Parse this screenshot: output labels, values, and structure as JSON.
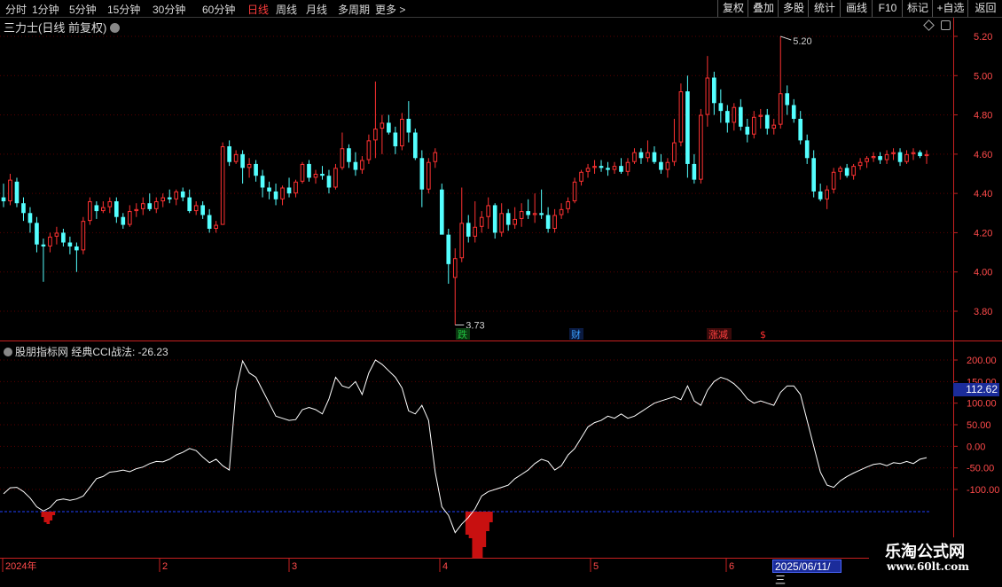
{
  "toolbar": {
    "periods": [
      {
        "label": "分时",
        "active": false
      },
      {
        "label": "1分钟",
        "active": false
      },
      {
        "label": "5分钟",
        "active": false
      },
      {
        "label": "15分钟",
        "active": false
      },
      {
        "label": "30分钟",
        "active": false
      },
      {
        "label": "60分钟",
        "active": false
      },
      {
        "label": "日线",
        "active": true
      },
      {
        "label": "周线",
        "active": false
      },
      {
        "label": "月线",
        "active": false
      },
      {
        "label": "多周期",
        "active": false
      },
      {
        "label": "更多 >",
        "active": false
      }
    ],
    "right_buttons": [
      "复权",
      "叠加",
      "多股",
      "统计",
      "画线",
      "F10",
      "标记",
      "+自选",
      "返回"
    ]
  },
  "main_chart": {
    "title": "三力士(日线 前复权)",
    "price_ticks": [
      "5.20",
      "5.00",
      "4.80",
      "4.60",
      "4.40",
      "4.20",
      "4.00",
      "3.80"
    ],
    "high_marker": "5.20",
    "low_marker": "3.73",
    "event_tags": [
      {
        "text": "跌",
        "color": "#20c040",
        "bg": "#0a3a10"
      },
      {
        "text": "财",
        "color": "#3aa0ff",
        "bg": "#0a1a40"
      },
      {
        "text": "涨减",
        "color": "#ff4040",
        "bg": "#3a0a0a"
      },
      {
        "text": "$",
        "color": "#ff3030",
        "bg": "#000000"
      }
    ]
  },
  "indicator": {
    "title": "股朋指标网 经典CCI战法: -26.23",
    "current_value": "112.62",
    "ticks": [
      "200.00",
      "150.00",
      "100.00",
      "50.00",
      "0.00",
      "-50.00",
      "-100.00"
    ],
    "threshold": -100
  },
  "time_axis": {
    "labels": [
      "2024年",
      "2",
      "3",
      "4",
      "5",
      "6"
    ],
    "cursor_date": "2025/06/11/三"
  },
  "watermark": {
    "title": "乐淘公式网",
    "url": "www.60lt.com"
  },
  "colors": {
    "up": "#ff3232",
    "down": "#54ffff",
    "cci_line": "#ffffff",
    "cci_fill": "#c81010",
    "grid": "#5a0000",
    "axis": "#c82020"
  },
  "chart_data": [
    {
      "type": "candlestick",
      "title": "三力士(日线 前复权)",
      "ylim": [
        3.66,
        5.3
      ],
      "note_high": 5.2,
      "note_low": 3.73,
      "ohlc": [
        [
          4.38,
          4.45,
          4.33,
          4.36
        ],
        [
          4.36,
          4.5,
          4.34,
          4.47
        ],
        [
          4.46,
          4.48,
          4.33,
          4.35
        ],
        [
          4.35,
          4.38,
          4.26,
          4.3
        ],
        [
          4.3,
          4.33,
          4.2,
          4.25
        ],
        [
          4.25,
          4.28,
          4.1,
          4.14
        ],
        [
          4.14,
          4.17,
          3.95,
          4.13
        ],
        [
          4.13,
          4.2,
          4.1,
          4.18
        ],
        [
          4.18,
          4.23,
          4.14,
          4.2
        ],
        [
          4.2,
          4.22,
          4.13,
          4.15
        ],
        [
          4.15,
          4.18,
          4.09,
          4.13
        ],
        [
          4.13,
          4.15,
          4.0,
          4.11
        ],
        [
          4.11,
          4.28,
          4.09,
          4.26
        ],
        [
          4.26,
          4.38,
          4.24,
          4.36
        ],
        [
          4.34,
          4.36,
          4.27,
          4.31
        ],
        [
          4.31,
          4.36,
          4.3,
          4.33
        ],
        [
          4.33,
          4.38,
          4.3,
          4.36
        ],
        [
          4.36,
          4.38,
          4.25,
          4.28
        ],
        [
          4.28,
          4.3,
          4.22,
          4.24
        ],
        [
          4.24,
          4.34,
          4.23,
          4.31
        ],
        [
          4.31,
          4.35,
          4.28,
          4.32
        ],
        [
          4.32,
          4.38,
          4.29,
          4.35
        ],
        [
          4.35,
          4.4,
          4.31,
          4.32
        ],
        [
          4.32,
          4.38,
          4.3,
          4.36
        ],
        [
          4.36,
          4.4,
          4.33,
          4.38
        ],
        [
          4.38,
          4.42,
          4.35,
          4.37
        ],
        [
          4.37,
          4.42,
          4.34,
          4.41
        ],
        [
          4.41,
          4.43,
          4.36,
          4.38
        ],
        [
          4.38,
          4.42,
          4.3,
          4.31
        ],
        [
          4.31,
          4.36,
          4.29,
          4.34
        ],
        [
          4.34,
          4.36,
          4.27,
          4.29
        ],
        [
          4.29,
          4.32,
          4.2,
          4.22
        ],
        [
          4.22,
          4.26,
          4.2,
          4.24
        ],
        [
          4.24,
          4.66,
          4.24,
          4.64
        ],
        [
          4.64,
          4.67,
          4.54,
          4.56
        ],
        [
          4.56,
          4.62,
          4.55,
          4.6
        ],
        [
          4.6,
          4.62,
          4.45,
          4.53
        ],
        [
          4.53,
          4.58,
          4.48,
          4.55
        ],
        [
          4.55,
          4.57,
          4.46,
          4.49
        ],
        [
          4.49,
          4.52,
          4.38,
          4.43
        ],
        [
          4.43,
          4.46,
          4.37,
          4.41
        ],
        [
          4.41,
          4.45,
          4.34,
          4.37
        ],
        [
          4.37,
          4.44,
          4.34,
          4.43
        ],
        [
          4.43,
          4.48,
          4.38,
          4.4
        ],
        [
          4.4,
          4.47,
          4.38,
          4.46
        ],
        [
          4.46,
          4.56,
          4.45,
          4.55
        ],
        [
          4.55,
          4.57,
          4.46,
          4.48
        ],
        [
          4.48,
          4.52,
          4.45,
          4.5
        ],
        [
          4.5,
          4.54,
          4.47,
          4.49
        ],
        [
          4.49,
          4.52,
          4.4,
          4.43
        ],
        [
          4.43,
          4.55,
          4.42,
          4.53
        ],
        [
          4.53,
          4.71,
          4.52,
          4.63
        ],
        [
          4.63,
          4.65,
          4.53,
          4.56
        ],
        [
          4.56,
          4.61,
          4.49,
          4.52
        ],
        [
          4.52,
          4.59,
          4.5,
          4.57
        ],
        [
          4.57,
          4.7,
          4.55,
          4.67
        ],
        [
          4.67,
          4.97,
          4.58,
          4.73
        ],
        [
          4.73,
          4.8,
          4.6,
          4.76
        ],
        [
          4.76,
          4.8,
          4.7,
          4.71
        ],
        [
          4.71,
          4.74,
          4.6,
          4.64
        ],
        [
          4.64,
          4.81,
          4.62,
          4.78
        ],
        [
          4.78,
          4.87,
          4.66,
          4.71
        ],
        [
          4.71,
          4.73,
          4.57,
          4.58
        ],
        [
          4.58,
          4.62,
          4.33,
          4.42
        ],
        [
          4.42,
          4.58,
          4.4,
          4.56
        ],
        [
          4.56,
          4.63,
          4.53,
          4.61
        ],
        [
          4.42,
          4.45,
          4.2,
          4.19
        ],
        [
          4.19,
          4.22,
          3.94,
          4.04
        ],
        [
          3.97,
          4.12,
          3.73,
          4.07
        ],
        [
          4.07,
          4.43,
          4.05,
          4.25
        ],
        [
          4.25,
          4.29,
          4.15,
          4.18
        ],
        [
          4.18,
          4.36,
          4.15,
          4.23
        ],
        [
          4.23,
          4.31,
          4.2,
          4.28
        ],
        [
          4.28,
          4.38,
          4.22,
          4.34
        ],
        [
          4.34,
          4.35,
          4.17,
          4.2
        ],
        [
          4.2,
          4.35,
          4.18,
          4.3
        ],
        [
          4.3,
          4.32,
          4.21,
          4.24
        ],
        [
          4.24,
          4.33,
          4.22,
          4.27
        ],
        [
          4.27,
          4.35,
          4.23,
          4.31
        ],
        [
          4.31,
          4.37,
          4.27,
          4.29
        ],
        [
          4.29,
          4.4,
          4.25,
          4.3
        ],
        [
          4.3,
          4.42,
          4.27,
          4.29
        ],
        [
          4.29,
          4.33,
          4.2,
          4.22
        ],
        [
          4.22,
          4.32,
          4.2,
          4.29
        ],
        [
          4.29,
          4.35,
          4.27,
          4.32
        ],
        [
          4.32,
          4.38,
          4.3,
          4.36
        ],
        [
          4.36,
          4.48,
          4.35,
          4.46
        ],
        [
          4.46,
          4.52,
          4.44,
          4.51
        ],
        [
          4.51,
          4.55,
          4.48,
          4.53
        ],
        [
          4.53,
          4.57,
          4.5,
          4.54
        ],
        [
          4.54,
          4.57,
          4.51,
          4.53
        ],
        [
          4.53,
          4.56,
          4.49,
          4.52
        ],
        [
          4.52,
          4.56,
          4.5,
          4.54
        ],
        [
          4.54,
          4.58,
          4.5,
          4.51
        ],
        [
          4.51,
          4.58,
          4.49,
          4.56
        ],
        [
          4.56,
          4.63,
          4.55,
          4.61
        ],
        [
          4.61,
          4.63,
          4.55,
          4.58
        ],
        [
          4.58,
          4.67,
          4.56,
          4.61
        ],
        [
          4.61,
          4.64,
          4.55,
          4.56
        ],
        [
          4.56,
          4.6,
          4.5,
          4.52
        ],
        [
          4.52,
          4.58,
          4.48,
          4.56
        ],
        [
          4.56,
          4.78,
          4.54,
          4.66
        ],
        [
          4.66,
          4.96,
          4.64,
          4.92
        ],
        [
          4.92,
          5.0,
          4.48,
          4.55
        ],
        [
          4.55,
          4.6,
          4.45,
          4.47
        ],
        [
          4.47,
          4.83,
          4.45,
          4.8
        ],
        [
          4.8,
          5.1,
          4.74,
          4.99
        ],
        [
          4.99,
          5.02,
          4.8,
          4.86
        ],
        [
          4.86,
          4.93,
          4.76,
          4.82
        ],
        [
          4.82,
          4.85,
          4.71,
          4.76
        ],
        [
          4.76,
          4.86,
          4.72,
          4.84
        ],
        [
          4.84,
          4.88,
          4.72,
          4.74
        ],
        [
          4.74,
          4.78,
          4.66,
          4.7
        ],
        [
          4.7,
          4.82,
          4.68,
          4.79
        ],
        [
          4.79,
          4.83,
          4.73,
          4.8
        ],
        [
          4.8,
          4.83,
          4.7,
          4.73
        ],
        [
          4.73,
          4.78,
          4.7,
          4.75
        ],
        [
          4.75,
          5.2,
          4.73,
          4.91
        ],
        [
          4.91,
          4.95,
          4.8,
          4.85
        ],
        [
          4.85,
          4.88,
          4.76,
          4.78
        ],
        [
          4.78,
          4.82,
          4.65,
          4.67
        ],
        [
          4.67,
          4.7,
          4.55,
          4.58
        ],
        [
          4.58,
          4.62,
          4.38,
          4.41
        ],
        [
          4.41,
          4.45,
          4.36,
          4.37
        ],
        [
          4.37,
          4.44,
          4.32,
          4.42
        ],
        [
          4.42,
          4.53,
          4.4,
          4.51
        ],
        [
          4.51,
          4.54,
          4.47,
          4.53
        ],
        [
          4.53,
          4.55,
          4.48,
          4.49
        ],
        [
          4.49,
          4.55,
          4.47,
          4.54
        ],
        [
          4.54,
          4.58,
          4.52,
          4.56
        ],
        [
          4.56,
          4.59,
          4.53,
          4.58
        ],
        [
          4.58,
          4.61,
          4.56,
          4.59
        ],
        [
          4.59,
          4.61,
          4.55,
          4.57
        ],
        [
          4.57,
          4.62,
          4.55,
          4.6
        ],
        [
          4.6,
          4.63,
          4.57,
          4.61
        ],
        [
          4.61,
          4.63,
          4.54,
          4.56
        ],
        [
          4.56,
          4.62,
          4.55,
          4.6
        ],
        [
          4.6,
          4.63,
          4.57,
          4.61
        ],
        [
          4.61,
          4.62,
          4.58,
          4.59
        ],
        [
          4.59,
          4.62,
          4.55,
          4.6
        ]
      ]
    },
    {
      "type": "line",
      "title": "股朋指标网 经典CCI战法",
      "ylim": [
        -250,
        230
      ],
      "threshold": -100,
      "values": [
        -110,
        -96,
        -95,
        -105,
        -120,
        -140,
        -150,
        -142,
        -125,
        -122,
        -125,
        -122,
        -115,
        -95,
        -75,
        -70,
        -60,
        -58,
        -55,
        -59,
        -52,
        -48,
        -40,
        -35,
        -36,
        -30,
        -20,
        -14,
        -5,
        -10,
        -25,
        -38,
        -30,
        -45,
        -55,
        130,
        198,
        170,
        160,
        130,
        100,
        70,
        65,
        60,
        62,
        85,
        90,
        85,
        75,
        110,
        160,
        140,
        135,
        150,
        120,
        170,
        200,
        190,
        175,
        160,
        135,
        82,
        75,
        95,
        60,
        -60,
        -140,
        -160,
        -200,
        -180,
        -165,
        -145,
        -115,
        -105,
        -100,
        -95,
        -90,
        -75,
        -65,
        -55,
        -40,
        -30,
        -35,
        -55,
        -45,
        -20,
        -5,
        20,
        45,
        55,
        60,
        70,
        65,
        75,
        65,
        70,
        80,
        90,
        100,
        105,
        110,
        115,
        108,
        140,
        105,
        95,
        130,
        150,
        160,
        155,
        145,
        130,
        110,
        100,
        105,
        100,
        95,
        125,
        140,
        140,
        120,
        60,
        0,
        -60,
        -90,
        -95,
        -80,
        -70,
        -62,
        -55,
        -48,
        -42,
        -40,
        -45,
        -38,
        -40,
        -35,
        -40,
        -30,
        -26.23
      ],
      "fill_below_threshold": [
        {
          "start": 45,
          "end": 63,
          "depth_px": [
            0,
            6,
            12,
            14,
            10,
            4,
            0
          ]
        },
        {
          "start": 523,
          "end": 557,
          "depth_px": [
            0,
            26,
            30,
            52,
            52,
            52,
            40,
            22,
            12,
            0
          ]
        }
      ]
    }
  ]
}
